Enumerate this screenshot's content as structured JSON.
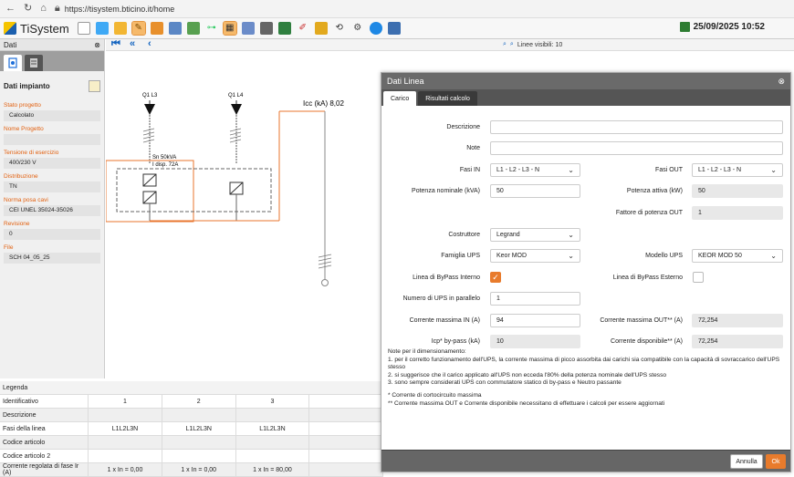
{
  "browser": {
    "url": "https://tisystem.bticino.it/home"
  },
  "app": {
    "title": "TiSystem",
    "datetime": "25/09/2025 10:52"
  },
  "left_panel": {
    "header": "Dati",
    "section_title": "Dati impianto",
    "fields": [
      {
        "label": "Stato progetto",
        "value": "Calcolato"
      },
      {
        "label": "Nome Progetto",
        "value": ""
      },
      {
        "label": "Tensione di esercizio",
        "value": "400/230 V"
      },
      {
        "label": "Distribuzione",
        "value": "TN"
      },
      {
        "label": "Norma posa cavi",
        "value": "CEI UNEL 35024-35026"
      },
      {
        "label": "Revisione",
        "value": "0"
      },
      {
        "label": "File",
        "value": "SCH 04_05_25"
      }
    ]
  },
  "diagram": {
    "linee_visibili": "Linee visibili: 10",
    "q1_l3": "Q1 L3",
    "q1_l4": "Q1 L4",
    "icc": "Icc (kA) 8,02",
    "sn": "Sn 50kVA",
    "idisp": "I disp. 72A"
  },
  "legenda": {
    "title": "Legenda",
    "rows": [
      {
        "label": "Identificativo",
        "values": [
          "1",
          "2",
          "3",
          ""
        ]
      },
      {
        "label": "Descrizione",
        "values": [
          "",
          "",
          "",
          ""
        ]
      },
      {
        "label": "Fasi della linea",
        "values": [
          "L1L2L3N",
          "L1L2L3N",
          "L1L2L3N",
          ""
        ]
      },
      {
        "label": "Codice articolo",
        "values": [
          "",
          "",
          "",
          ""
        ]
      },
      {
        "label": "Codice articolo 2",
        "values": [
          "",
          "",
          "",
          ""
        ]
      },
      {
        "label": "Corrente regolata di fase Ir (A)",
        "values": [
          "1 x In = 0,00",
          "1 x In = 0,00",
          "1 x In = 80,00",
          ""
        ]
      }
    ]
  },
  "modal": {
    "title": "Dati Linea",
    "tabs": [
      "Carico",
      "Risultati calcolo"
    ],
    "descrizione_label": "Descrizione",
    "descrizione_value": "",
    "note_label": "Note",
    "note_value": "",
    "fasi_in_label": "Fasi IN",
    "fasi_in_value": "L1 - L2 - L3 - N",
    "fasi_out_label": "Fasi OUT",
    "fasi_out_value": "L1 - L2 - L3 - N",
    "potenza_nominale_label": "Potenza nominale (kVA)",
    "potenza_nominale_value": "50",
    "potenza_attiva_label": "Potenza attiva (kW)",
    "potenza_attiva_value": "50",
    "fattore_label": "Fattore di potenza OUT",
    "fattore_value": "1",
    "costruttore_label": "Costruttore",
    "costruttore_value": "Legrand",
    "famiglia_label": "Famiglia UPS",
    "famiglia_value": "Keor MOD",
    "modello_label": "Modello UPS",
    "modello_value": "KEOR MOD 50",
    "bypass_interno_label": "Linea di ByPass Interno",
    "bypass_interno_checked": true,
    "bypass_esterno_label": "Linea di ByPass Esterno",
    "bypass_esterno_checked": false,
    "numero_ups_label": "Numero di UPS in parallelo",
    "numero_ups_value": "1",
    "corrente_in_label": "Corrente massima IN (A)",
    "corrente_in_value": "94",
    "corrente_out_label": "Corrente massima OUT** (A)",
    "corrente_out_value": "72,254",
    "icp_label": "Icp* by-pass (kA)",
    "icp_value": "10",
    "corrente_disp_label": "Corrente disponibile** (A)",
    "corrente_disp_value": "72,254",
    "notes": [
      "Note per il dimensionamento:",
      "1. per il corretto funzionamento dell'UPS, la corrente massima di picco assorbita dai carichi sia compatibile con la capacità di sovraccarico dell'UPS stesso",
      "2. si suggerisce che il carico applicato all'UPS non ecceda l'80% della potenza nominale dell'UPS stesso",
      "3. sono sempre considerati UPS con commutatore statico di by-pass e Neutro passante",
      "",
      "* Corrente di cortocircuito massima",
      "** Corrente massima OUT e Corrente disponibile necessitano di effettuare i calcoli per essere aggiornati"
    ],
    "btn_annulla": "Annulla",
    "btn_ok": "Ok"
  }
}
